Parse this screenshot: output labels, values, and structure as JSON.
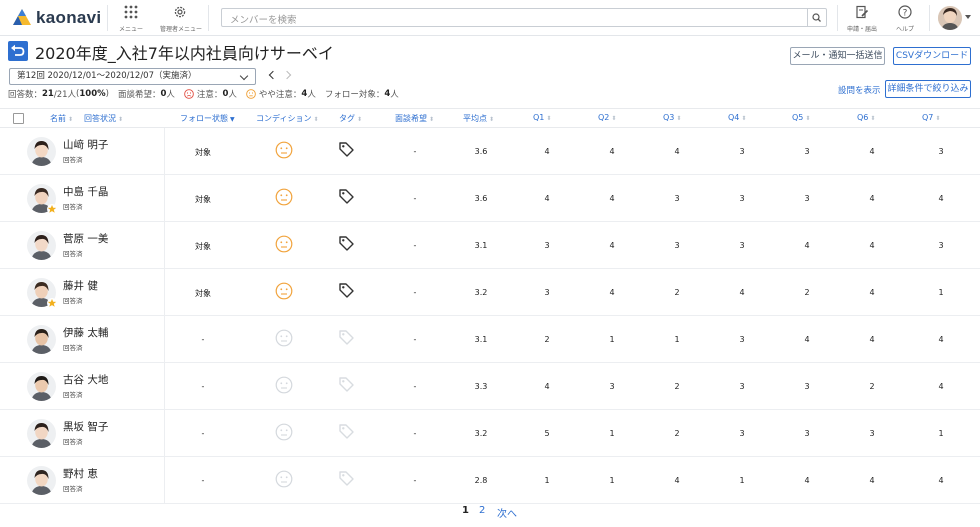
{
  "app": {
    "brand": "kaonavi"
  },
  "topnav": {
    "menu_label": "メニュー",
    "admin_label": "管理者メニュー",
    "search_placeholder": "メンバーを検索",
    "apply_label": "申請・届出",
    "help_label": "ヘルプ"
  },
  "page": {
    "title": "2020年度_入社7年以内社員向けサーベイ",
    "mail_button": "メール・通知一括送信",
    "csv_button": "CSVダウンロード",
    "round_select": "第12回  2020/12/01〜2020/12/07（実施済）",
    "show_questions": "設問を表示",
    "filter_button": "詳細条件で絞り込み"
  },
  "stats": {
    "responses_label": "回答数：",
    "responses_value": "21",
    "responses_total": "/21人",
    "responses_pct_open": " (",
    "responses_pct": "100%",
    "responses_pct_close": ")",
    "interview_label": "面談希望：",
    "interview_value": "0",
    "interview_unit": "人",
    "caution_label": "注意：",
    "caution_value": "0",
    "caution_unit": "人",
    "slight_label": "やや注意：",
    "slight_value": "4",
    "slight_unit": "人",
    "follow_label": "フォロー対象：",
    "follow_value": "4",
    "follow_unit": "人"
  },
  "columns": {
    "name": "名前",
    "status": "回答状況",
    "follow": "フォロー状態",
    "condition": "コンディション",
    "tag": "タグ",
    "interview": "面談希望",
    "avg": "平均点",
    "q1": "Q1",
    "q2": "Q2",
    "q3": "Q3",
    "q4": "Q4",
    "q5": "Q5",
    "q6": "Q6",
    "q7": "Q7"
  },
  "rows": [
    {
      "name": "山﨑 明子",
      "status": "回答済",
      "follow": "対象",
      "interview": "-",
      "avg": "3.6",
      "q1": "4",
      "q2": "4",
      "q3": "4",
      "q4": "3",
      "q5": "3",
      "q6": "4",
      "q7": "3"
    },
    {
      "name": "中島 千晶",
      "status": "回答済",
      "follow": "対象",
      "interview": "-",
      "avg": "3.6",
      "q1": "4",
      "q2": "4",
      "q3": "3",
      "q4": "3",
      "q5": "3",
      "q6": "4",
      "q7": "4"
    },
    {
      "name": "菅原 一美",
      "status": "回答済",
      "follow": "対象",
      "interview": "-",
      "avg": "3.1",
      "q1": "3",
      "q2": "4",
      "q3": "3",
      "q4": "3",
      "q5": "4",
      "q6": "4",
      "q7": "3"
    },
    {
      "name": "藤井 健",
      "status": "回答済",
      "follow": "対象",
      "interview": "-",
      "avg": "3.2",
      "q1": "3",
      "q2": "4",
      "q3": "2",
      "q4": "4",
      "q5": "2",
      "q6": "4",
      "q7": "1"
    },
    {
      "name": "伊藤 太輔",
      "status": "回答済",
      "follow": "-",
      "interview": "-",
      "avg": "3.1",
      "q1": "2",
      "q2": "1",
      "q3": "1",
      "q4": "3",
      "q5": "4",
      "q6": "4",
      "q7": "4"
    },
    {
      "name": "古谷 大地",
      "status": "回答済",
      "follow": "-",
      "interview": "-",
      "avg": "3.3",
      "q1": "4",
      "q2": "3",
      "q3": "2",
      "q4": "3",
      "q5": "3",
      "q6": "2",
      "q7": "4"
    },
    {
      "name": "黒坂 智子",
      "status": "回答済",
      "follow": "-",
      "interview": "-",
      "avg": "3.2",
      "q1": "5",
      "q2": "1",
      "q3": "2",
      "q4": "3",
      "q5": "3",
      "q6": "3",
      "q7": "1"
    },
    {
      "name": "野村 恵",
      "status": "回答済",
      "follow": "-",
      "interview": "-",
      "avg": "2.8",
      "q1": "1",
      "q2": "1",
      "q3": "4",
      "q4": "1",
      "q5": "4",
      "q6": "4",
      "q7": "4"
    }
  ],
  "pagination": {
    "page1": "1",
    "page2": "2",
    "next": "次へ"
  },
  "colors": {
    "accent": "#2e6fd0",
    "warn_face": "#f1a33c",
    "muted_face": "#d4d8dd"
  }
}
